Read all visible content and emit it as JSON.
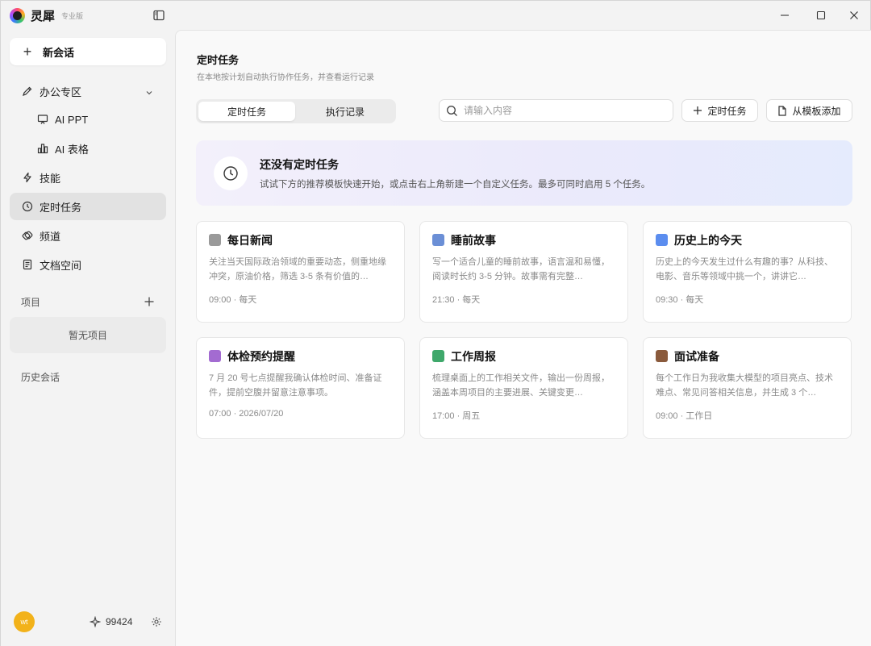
{
  "app": {
    "name": "灵犀",
    "edition": "专业版"
  },
  "sidebar": {
    "new_chat": "新会话",
    "items": [
      {
        "label": "办公专区"
      },
      {
        "label": "AI PPT"
      },
      {
        "label": "AI 表格"
      },
      {
        "label": "技能"
      },
      {
        "label": "定时任务"
      },
      {
        "label": "频道"
      },
      {
        "label": "文档空间"
      }
    ],
    "projects_label": "项目",
    "projects_empty": "暂无项目",
    "history_label": "历史会话",
    "user_initials": "wt",
    "credits": "99424"
  },
  "main": {
    "title": "定时任务",
    "subtitle": "在本地按计划自动执行协作任务，并查看运行记录",
    "tabs": [
      {
        "label": "定时任务"
      },
      {
        "label": "执行记录"
      }
    ],
    "search_placeholder": "请输入内容",
    "add_task": "定时任务",
    "add_template": "从模板添加",
    "empty_title": "还没有定时任务",
    "empty_desc": "试试下方的推荐模板快速开始，或点击右上角新建一个自定义任务。最多可同时启用 5 个任务。",
    "templates": [
      {
        "title": "每日新闻",
        "desc": "关注当天国际政治领域的重要动态，侧重地缘冲突，原油价格，筛选 3-5 条有价值的…",
        "meta": "09:00 · 每天",
        "icon": "newspaper-icon",
        "color": "#8c8c8c"
      },
      {
        "title": "睡前故事",
        "desc": "写一个适合儿童的睡前故事，语言温和易懂，阅读时长约 3-5 分钟。故事需有完整…",
        "meta": "21:30 · 每天",
        "icon": "open-book-icon",
        "color": "#6b8fd6"
      },
      {
        "title": "历史上的今天",
        "desc": "历史上的今天发生过什么有趣的事？从科技、电影、音乐等领域中挑一个，讲讲它…",
        "meta": "09:30 · 每天",
        "icon": "calendar-icon",
        "color": "#5b8def"
      },
      {
        "title": "体检预约提醒",
        "desc": "7 月 20 号七点提醒我确认体检时间、准备证件，提前空腹并留意注意事项。",
        "meta": "07:00 · 2026/07/20",
        "icon": "clipboard-icon",
        "color": "#a36bd1"
      },
      {
        "title": "工作周报",
        "desc": "梳理桌面上的工作相关文件，输出一份周报，涵盖本周项目的主要进展、关键变更…",
        "meta": "17:00 · 周五",
        "icon": "bar-chart-icon",
        "color": "#3fa86b"
      },
      {
        "title": "面试准备",
        "desc": "每个工作日为我收集大模型的项目亮点、技术难点、常见问答相关信息，并生成 3 个…",
        "meta": "09:00 · 工作日",
        "icon": "briefcase-icon",
        "color": "#8a5a3c"
      }
    ]
  }
}
